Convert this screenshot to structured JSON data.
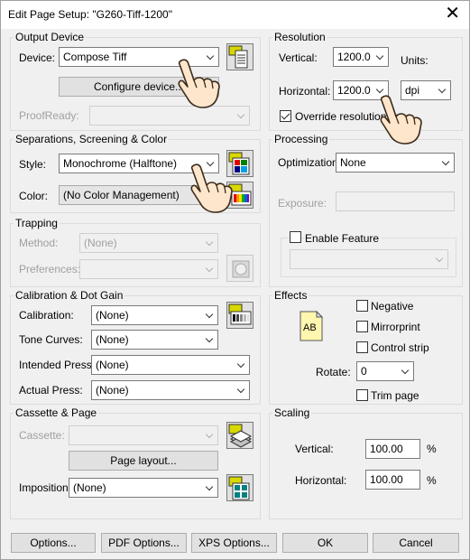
{
  "window": {
    "title": "Edit Page Setup: \"G260-Tiff-1200\"",
    "close_glyph": "✕"
  },
  "output_device": {
    "group_label": "Output Device",
    "device_label": "Device:",
    "device_value": "Compose Tiff",
    "configure_button": "Configure device...",
    "proofready_label": "ProofReady:",
    "proofready_value": ""
  },
  "separations": {
    "group_label": "Separations, Screening & Color",
    "style_label": "Style:",
    "style_value": "Monochrome (Halftone)",
    "color_label": "Color:",
    "color_value": "(No Color Management)"
  },
  "trapping": {
    "group_label": "Trapping",
    "method_label": "Method:",
    "method_value": "(None)",
    "preferences_label": "Preferences:",
    "preferences_value": ""
  },
  "calibration": {
    "group_label": "Calibration & Dot Gain",
    "calibration_label": "Calibration:",
    "calibration_value": "(None)",
    "tone_label": "Tone Curves:",
    "tone_value": "(None)",
    "intended_label": "Intended Press:",
    "intended_value": "(None)",
    "actual_label": "Actual Press:",
    "actual_value": "(None)"
  },
  "cassette": {
    "group_label": "Cassette & Page",
    "cassette_label": "Cassette:",
    "cassette_value": "",
    "page_layout_button": "Page layout...",
    "imposition_label": "Imposition:",
    "imposition_value": "(None)"
  },
  "resolution": {
    "group_label": "Resolution",
    "vertical_label": "Vertical:",
    "vertical_value": "1200.0",
    "units_label": "Units:",
    "horizontal_label": "Horizontal:",
    "horizontal_value": "1200.0",
    "units_value": "dpi",
    "override_label": "Override resolution in",
    "override_checked": true
  },
  "processing": {
    "group_label": "Processing",
    "optimization_label": "Optimization:",
    "optimization_value": "None",
    "exposure_label": "Exposure:",
    "exposure_value": "",
    "enable_feature_label": "Enable Feature",
    "feature_value": ""
  },
  "effects": {
    "group_label": "Effects",
    "negative_label": "Negative",
    "mirrorprint_label": "Mirrorprint",
    "control_strip_label": "Control strip",
    "rotate_label": "Rotate:",
    "rotate_value": "0",
    "trim_page_label": "Trim page",
    "ab_icon_text": "AB"
  },
  "scaling": {
    "group_label": "Scaling",
    "vertical_label": "Vertical:",
    "vertical_value": "100.00",
    "vertical_unit": "%",
    "horizontal_label": "Horizontal:",
    "horizontal_value": "100.00",
    "horizontal_unit": "%"
  },
  "footer": {
    "options": "Options...",
    "pdf_options": "PDF Options...",
    "xps_options": "XPS Options...",
    "ok": "OK",
    "cancel": "Cancel"
  }
}
